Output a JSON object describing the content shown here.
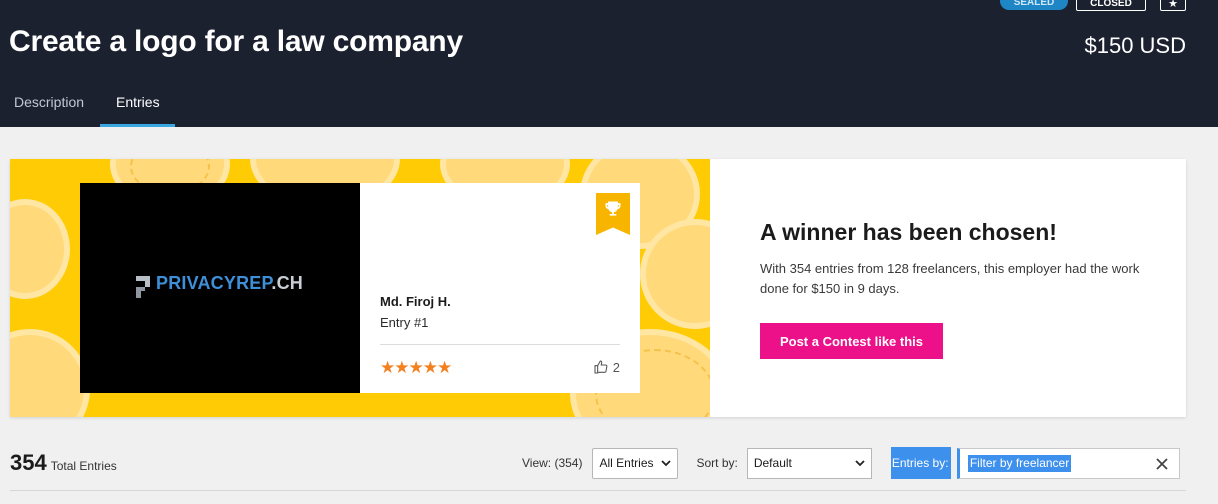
{
  "header": {
    "badges": {
      "sealed": "SEALED",
      "closed": "CLOSED"
    },
    "title": "Create a logo for a law company",
    "price": "$150 USD",
    "tabs": [
      {
        "label": "Description",
        "active": false
      },
      {
        "label": "Entries",
        "active": true
      }
    ]
  },
  "winner_card": {
    "logo": {
      "primary": "PRIVACYREP",
      "suffix": ".CH"
    },
    "freelancer_name": "Md. Firoj H.",
    "entry_number": "Entry #1",
    "rating": 5,
    "stars_text": "★★★★★",
    "likes": "2",
    "heading": "A winner has been chosen!",
    "description": "With 354 entries from 128 freelancers, this employer had the work done for $150 in 9 days.",
    "cta_label": "Post a Contest like this"
  },
  "filters": {
    "total_count": "354",
    "total_label": "Total Entries",
    "view_label": "View: (354)",
    "view_value": "All Entries",
    "sort_label": "Sort by:",
    "sort_value": "Default",
    "entries_by_label": "Entries by:",
    "search_placeholder": "Filter by freelancer"
  },
  "colors": {
    "header_bg": "#1c2130",
    "tab_underline": "#3aa7e0",
    "banner_yellow": "#ffcb05",
    "cta_pink": "#ec1189",
    "star_orange": "#f4811f",
    "selection_blue": "#3e90ed"
  },
  "icons": [
    "trophy-icon",
    "thumbs-up-icon",
    "star-icon",
    "chevron-down-icon",
    "close-icon"
  ]
}
